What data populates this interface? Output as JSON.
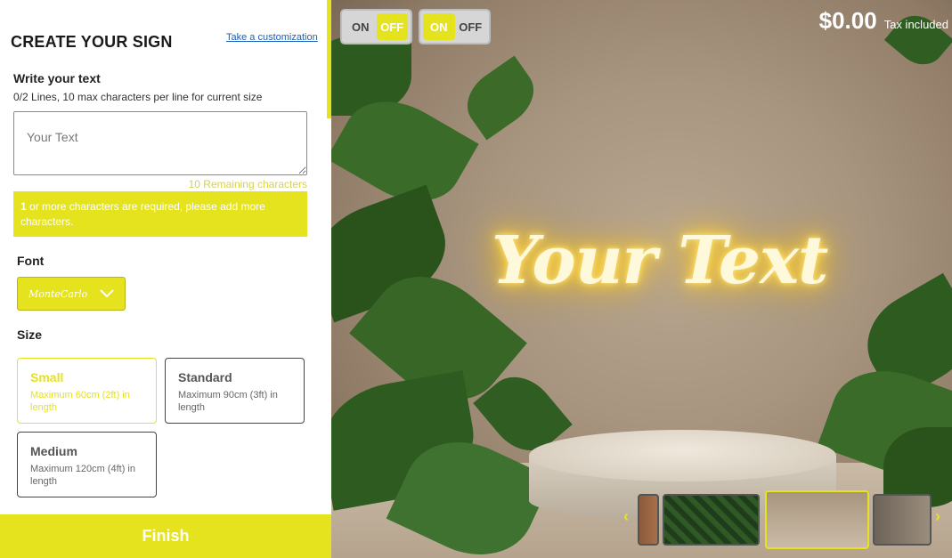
{
  "panel": {
    "title": "CREATE YOUR SIGN",
    "take_customization": "Take a customization",
    "write_label": "Write your text",
    "lines_info": "0/2 Lines, 10 max characters per line for current size",
    "text_placeholder": "Your Text",
    "remaining": "10 Remaining characters",
    "warning_count": "1",
    "warning_text": " or more characters are required, please add more characters.",
    "font_label": "Font",
    "font_selected": "MonteCarlo",
    "size_label": "Size",
    "sizes": [
      {
        "name": "Small",
        "desc": "Maximum 60cm (2ft) in length",
        "selected": true
      },
      {
        "name": "Standard",
        "desc": "Maximum 90cm (3ft) in length",
        "selected": false
      },
      {
        "name": "Medium",
        "desc": "Maximum 120cm (4ft) in length",
        "selected": false
      }
    ],
    "finish": "Finish"
  },
  "preview": {
    "neon_text": "Your Text",
    "toggle1": {
      "on": "ON",
      "off": "OFF",
      "active": "off"
    },
    "toggle2": {
      "on": "ON",
      "off": "OFF",
      "active": "on"
    },
    "price": "$0.00",
    "tax": "Tax included",
    "thumbnail_count": 4,
    "selected_thumbnail": 3
  },
  "colors": {
    "accent": "#e5e21e",
    "link": "#1a5fb4"
  },
  "icons": {
    "dropdown": "chevron-down-icon",
    "prev": "chevron-left-icon",
    "next": "chevron-right-icon"
  }
}
